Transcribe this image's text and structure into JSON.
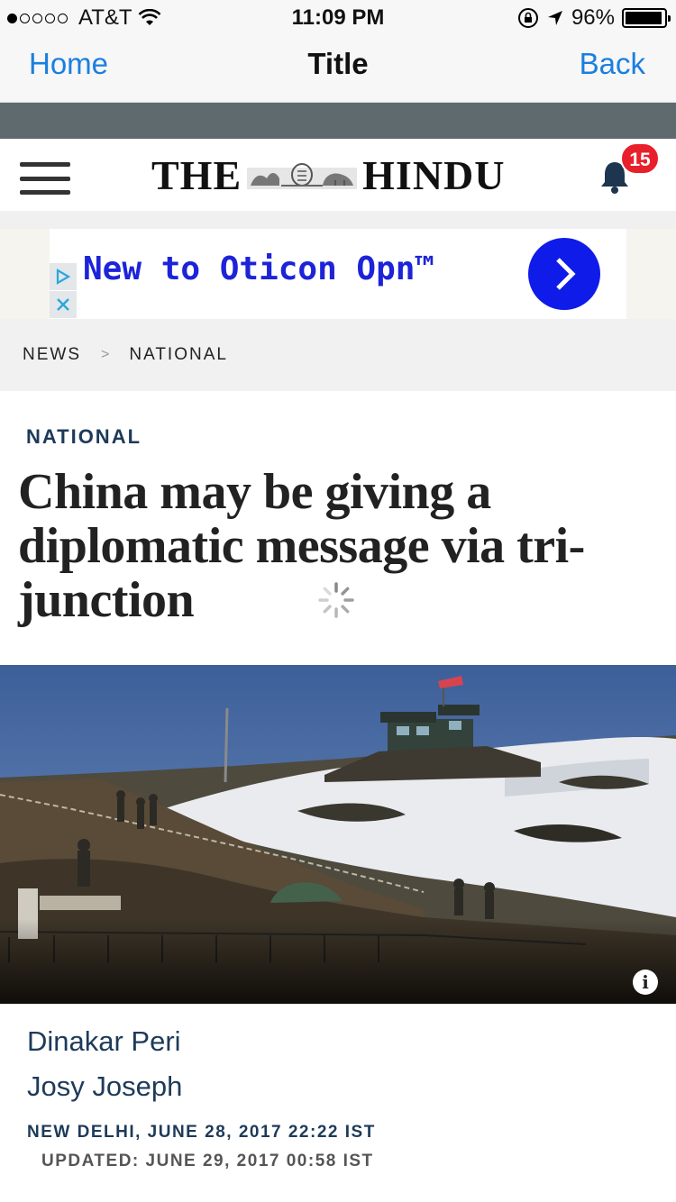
{
  "status_bar": {
    "carrier": "AT&T",
    "time": "11:09 PM",
    "battery": "96%",
    "battery_level": 0.96,
    "signal_bars_filled": 1,
    "signal_bars_total": 5
  },
  "nav": {
    "home_label": "Home",
    "title": "Title",
    "back_label": "Back"
  },
  "masthead": {
    "logo_left": "THE",
    "logo_right": "HINDU",
    "notification_count": "15",
    "icons": [
      "hamburger-menu-icon",
      "bell-icon"
    ]
  },
  "ad": {
    "text": "New to Oticon Opn™",
    "icons": [
      "adchoices-icon",
      "close-icon",
      "chevron-right-icon"
    ],
    "button_color": "#0f1be8",
    "text_color": "#1d23d8"
  },
  "breadcrumb": {
    "items": [
      "NEWS",
      "NATIONAL"
    ],
    "separator": ">"
  },
  "article": {
    "section": "NATIONAL",
    "headline": "China may be giving a diplomatic message via tri-junction",
    "authors": [
      "Dinakar Peri",
      "Josy Joseph"
    ],
    "dateline": "NEW DELHI, JUNE 28, 2017 22:22 IST",
    "updated": "UPDATED: JUNE 29, 2017 00:58 IST"
  },
  "colors": {
    "link_blue": "#1a7fe0",
    "section_navy": "#1d3a5a",
    "badge_red": "#e8202b"
  }
}
